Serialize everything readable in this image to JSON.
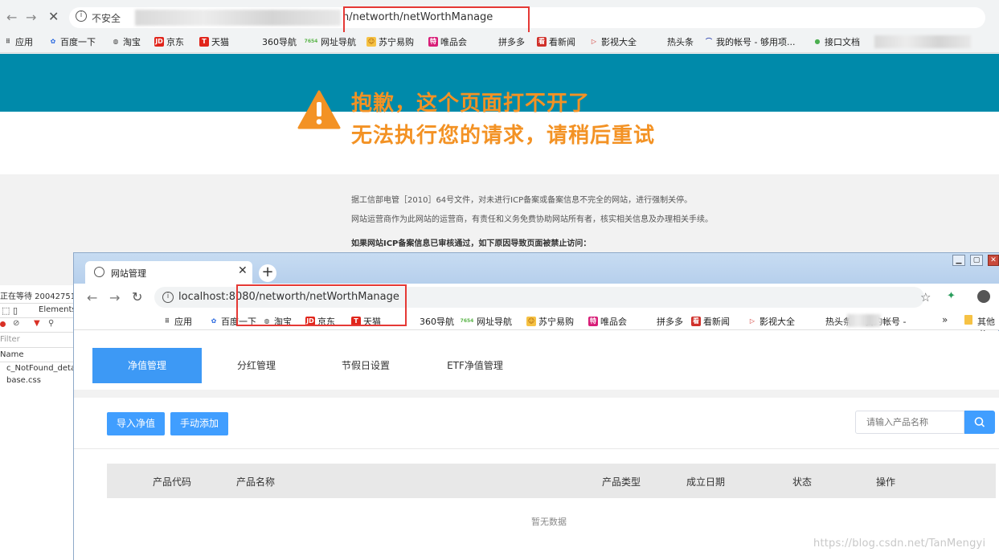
{
  "back_browser": {
    "insecure_label": "不安全",
    "url_tail": "n/networth/netWorthManage",
    "bookmarks": [
      {
        "label": "应用",
        "icon": "apps-grid-icon"
      },
      {
        "label": "百度一下",
        "icon": "baidu-paw-icon"
      },
      {
        "label": "淘宝",
        "icon": "globe-icon"
      },
      {
        "label": "京东",
        "icon": "jd-icon"
      },
      {
        "label": "天猫",
        "icon": "tmall-icon"
      },
      {
        "label": "360导航",
        "icon": ""
      },
      {
        "label": "网址导航",
        "icon": "7654-icon"
      },
      {
        "label": "苏宁易购",
        "icon": "suning-icon"
      },
      {
        "label": "唯品会",
        "icon": "vip-icon"
      },
      {
        "label": "拼多多",
        "icon": ""
      },
      {
        "label": "看新闻",
        "icon": "news-icon"
      },
      {
        "label": "影视大全",
        "icon": "play-icon"
      },
      {
        "label": "热头条",
        "icon": ""
      },
      {
        "label": "我的帐号 - 够用项...",
        "icon": "arc-icon"
      },
      {
        "label": "接口文档",
        "icon": "circle-icon"
      }
    ],
    "error_line1": "抱歉，这个页面打不开了",
    "error_line2": "无法执行您的请求，请稍后重试",
    "para1": "据工信部电管［2010］64号文件，对未进行ICP备案或备案信息不完全的网站，进行强制关停。",
    "para2": "网站运营商作为此网站的运营商，有责任和义务免费协助网站所有者，核实相关信息及办理相关手续。",
    "para3": "如果网站ICP备案信息已审核通过，如下原因导致页面被禁止访问："
  },
  "devtools": {
    "status": "正在等待 20042751",
    "tab_elements": "Elements",
    "filter_placeholder": "Filter",
    "col_name": "Name",
    "files": [
      "c_NotFound_deta",
      "base.css"
    ]
  },
  "front_browser": {
    "tab_title": "网站管理",
    "url": "localhost:8080/networth/netWorthManage",
    "bookmarks": [
      {
        "label": "应用",
        "icon": "apps-grid-icon"
      },
      {
        "label": "百度一下",
        "icon": "baidu-paw-icon"
      },
      {
        "label": "淘宝",
        "icon": "globe-icon"
      },
      {
        "label": "京东",
        "icon": "jd-icon"
      },
      {
        "label": "天猫",
        "icon": "tmall-icon"
      },
      {
        "label": "360导航",
        "icon": ""
      },
      {
        "label": "网址导航",
        "icon": "7654-icon"
      },
      {
        "label": "苏宁易购",
        "icon": "suning-icon"
      },
      {
        "label": "唯品会",
        "icon": "vip-icon"
      },
      {
        "label": "拼多多",
        "icon": ""
      },
      {
        "label": "看新闻",
        "icon": "news-icon"
      },
      {
        "label": "影视大全",
        "icon": "play-icon"
      },
      {
        "label": "热头条",
        "icon": ""
      },
      {
        "label": "我的帐号 -",
        "icon": "arc-icon"
      }
    ],
    "more_bookmarks": "»",
    "other_bookmarks": "其他书"
  },
  "app": {
    "menu": [
      "净值管理",
      "分红管理",
      "节假日设置",
      "ETF净值管理"
    ],
    "active_menu": 0,
    "import_button": "导入净值",
    "add_button": "手动添加",
    "search_placeholder": "请输入产品名称",
    "columns": [
      "产品代码",
      "产品名称",
      "产品类型",
      "成立日期",
      "状态",
      "操作"
    ],
    "empty_text": "暂无数据"
  },
  "watermark": "https://blog.csdn.net/TanMengyi",
  "colors": {
    "teal": "#008aaa",
    "warn": "#f39224",
    "primary": "#409eff",
    "red": "#e53935"
  }
}
